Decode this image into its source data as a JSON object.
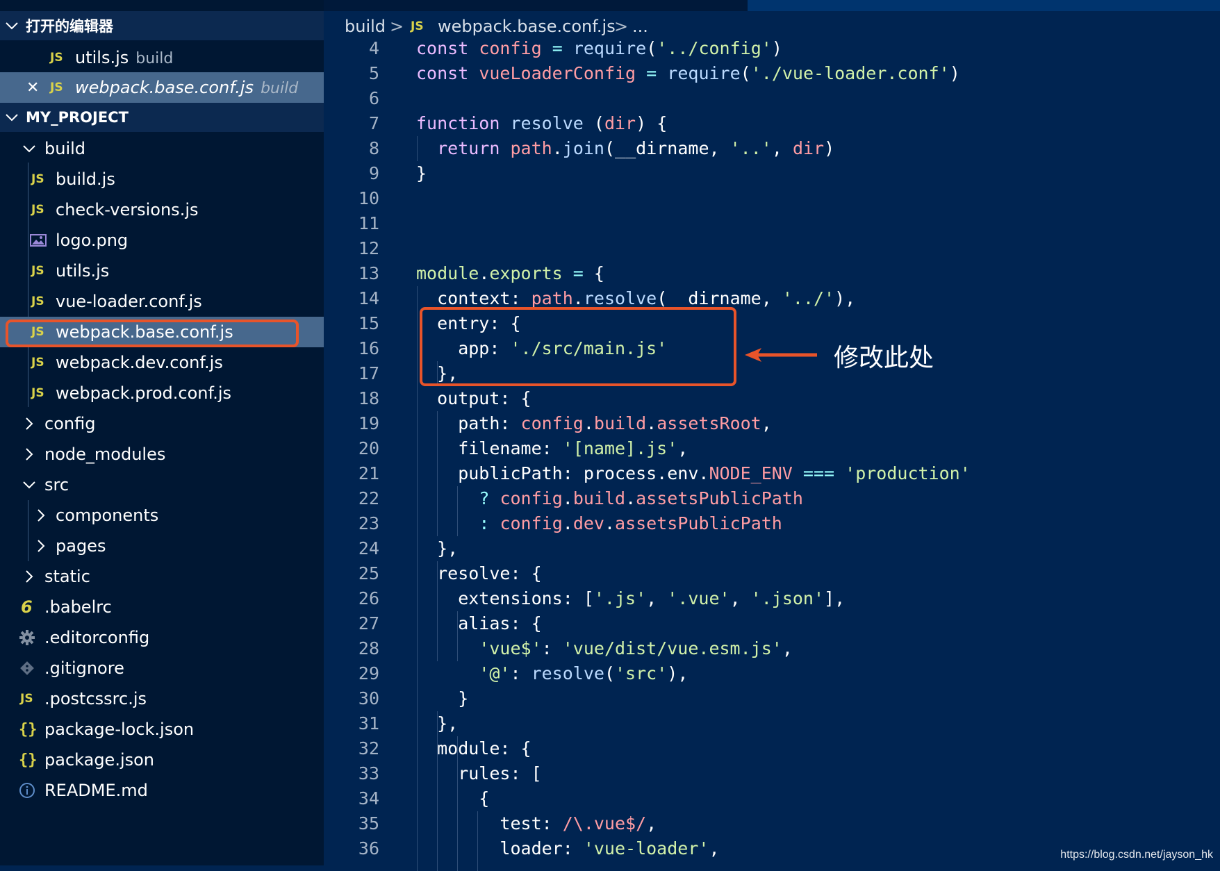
{
  "sidebar": {
    "open_editors": {
      "title": "打开的编辑器",
      "items": [
        {
          "icon": "JS",
          "name": "utils.js",
          "desc": "build"
        },
        {
          "icon": "JS",
          "name": "webpack.base.conf.js",
          "desc": "build",
          "close": "✕"
        }
      ]
    },
    "project": {
      "title": "MY_PROJECT",
      "items": [
        {
          "type": "folder",
          "name": "build",
          "expanded": true
        },
        {
          "type": "js",
          "icon": "JS",
          "name": "build.js"
        },
        {
          "type": "js",
          "icon": "JS",
          "name": "check-versions.js"
        },
        {
          "type": "image",
          "name": "logo.png"
        },
        {
          "type": "js",
          "icon": "JS",
          "name": "utils.js"
        },
        {
          "type": "js",
          "icon": "JS",
          "name": "vue-loader.conf.js"
        },
        {
          "type": "js",
          "icon": "JS",
          "name": "webpack.base.conf.js",
          "selected": true
        },
        {
          "type": "js",
          "icon": "JS",
          "name": "webpack.dev.conf.js"
        },
        {
          "type": "js",
          "icon": "JS",
          "name": "webpack.prod.conf.js"
        },
        {
          "type": "folder",
          "name": "config",
          "expanded": false
        },
        {
          "type": "folder",
          "name": "node_modules",
          "expanded": false
        },
        {
          "type": "folder",
          "name": "src",
          "expanded": true
        },
        {
          "type": "folder",
          "name": "components",
          "expanded": false
        },
        {
          "type": "folder",
          "name": "pages",
          "expanded": false
        },
        {
          "type": "folder",
          "name": "static",
          "expanded": false
        },
        {
          "type": "babel",
          "icon": "6",
          "name": ".babelrc"
        },
        {
          "type": "gear",
          "name": ".editorconfig"
        },
        {
          "type": "git",
          "name": ".gitignore"
        },
        {
          "type": "js",
          "icon": "JS",
          "name": ".postcssrc.js"
        },
        {
          "type": "json",
          "icon": "{}",
          "name": "package-lock.json"
        },
        {
          "type": "json",
          "icon": "{}",
          "name": "package.json"
        },
        {
          "type": "info",
          "name": "README.md"
        }
      ]
    }
  },
  "breadcrumb": {
    "folder": "build",
    "sep": ">",
    "file_icon": "JS",
    "file": "webpack.base.conf.js",
    "more": "..."
  },
  "code": {
    "line_numbers": [
      "4",
      "5",
      "6",
      "7",
      "8",
      "9",
      "10",
      "11",
      "12",
      "13",
      "14",
      "15",
      "16",
      "17",
      "18",
      "19",
      "20",
      "21",
      "22",
      "23",
      "24",
      "25",
      "26",
      "27",
      "28",
      "29",
      "30",
      "31",
      "32",
      "33",
      "34",
      "35",
      "36"
    ]
  },
  "annotation": {
    "text": "修改此处",
    "color": "#e8542a"
  },
  "watermark": "https://blog.csdn.net/jayson_hk",
  "colors": {
    "editor_bg": "#002451",
    "sidebar_bg": "#001733",
    "keyword": "#ebbbff",
    "variable": "#ff9da4",
    "function": "#bbdaff",
    "string": "#d1f1a9",
    "operator": "#99ffff",
    "js_icon": "#d9d24a"
  }
}
